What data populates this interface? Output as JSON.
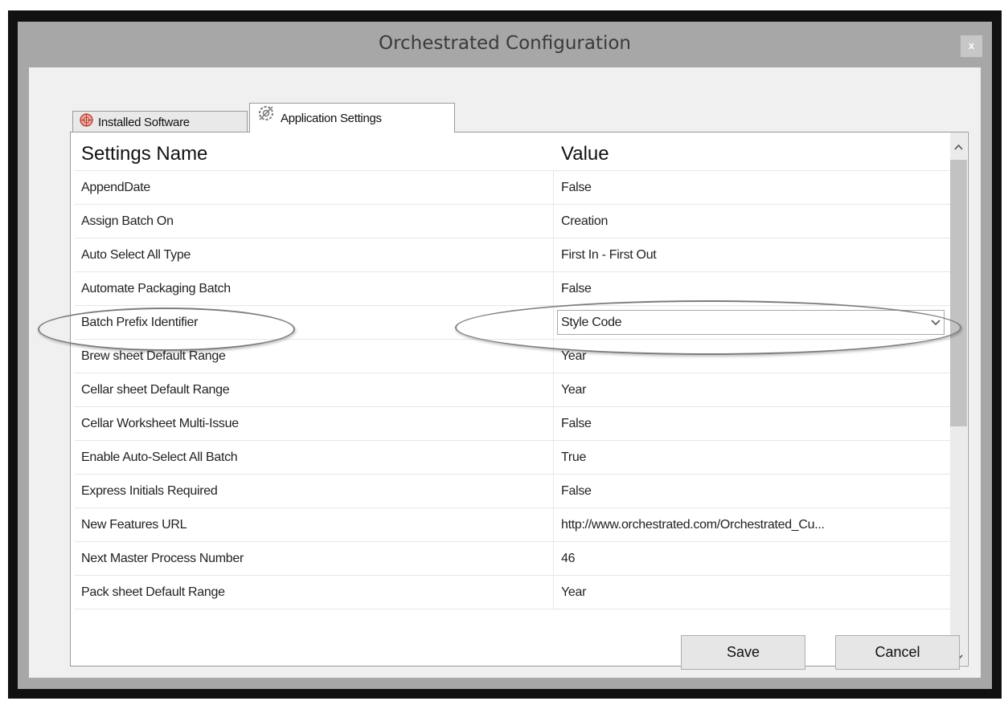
{
  "window": {
    "title": "Orchestrated Configuration",
    "close_label": "x"
  },
  "tabs": [
    {
      "label": "Installed Software",
      "icon": "installed-software-icon",
      "selected": false
    },
    {
      "label": "Application Settings",
      "icon": "gear-icon",
      "selected": true
    }
  ],
  "grid": {
    "columns": [
      "Settings Name",
      "Value"
    ],
    "rows": [
      {
        "name": "AppendDate",
        "value": "False"
      },
      {
        "name": "Assign Batch On",
        "value": "Creation"
      },
      {
        "name": "Auto Select All Type",
        "value": "First In - First Out"
      },
      {
        "name": "Automate Packaging Batch",
        "value": "False"
      },
      {
        "name": "Batch Prefix Identifier",
        "value": "Style Code",
        "editor": "dropdown"
      },
      {
        "name": "Brew sheet Default Range",
        "value": "Year"
      },
      {
        "name": "Cellar sheet Default Range",
        "value": "Year"
      },
      {
        "name": "Cellar Worksheet Multi-Issue",
        "value": "False"
      },
      {
        "name": "Enable Auto-Select All Batch",
        "value": "True"
      },
      {
        "name": "Express Initials Required",
        "value": "False"
      },
      {
        "name": "New Features URL",
        "value": "http://www.orchestrated.com/Orchestrated_Cu..."
      },
      {
        "name": "Next Master Process Number",
        "value": "46"
      },
      {
        "name": "Pack sheet Default Range",
        "value": "Year"
      }
    ]
  },
  "buttons": {
    "save_label": "Save",
    "cancel_label": "Cancel"
  },
  "colors": {
    "window_chrome": "#a7a7a7",
    "client_background": "#f0f0f0",
    "grid_background": "#ffffff"
  }
}
